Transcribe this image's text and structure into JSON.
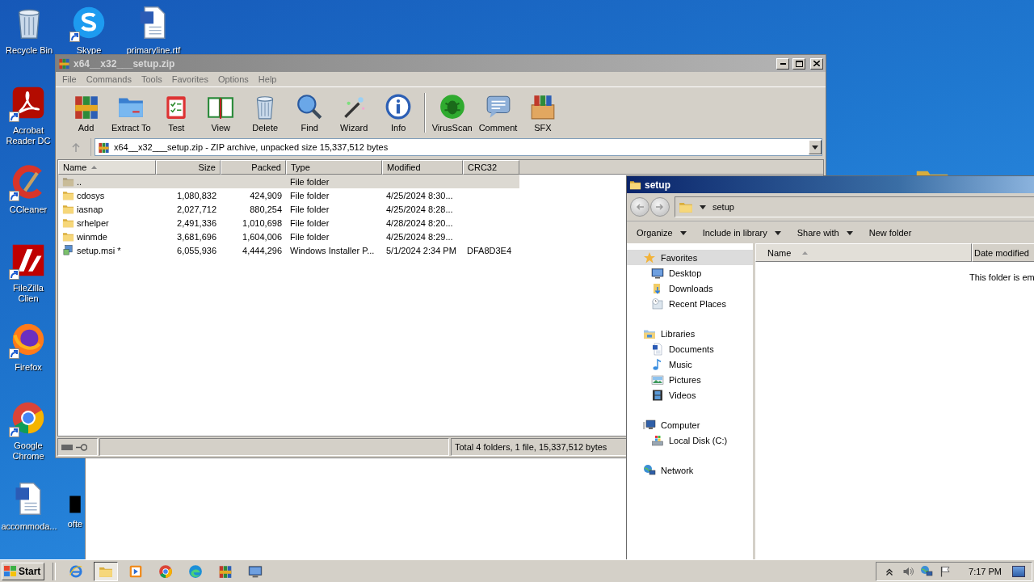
{
  "desktop_icons": [
    {
      "kind": "recycle-bin",
      "label": "Recycle Bin",
      "shortcut": false
    },
    {
      "kind": "skype",
      "label": "Skype",
      "shortcut": true
    },
    {
      "kind": "word-doc",
      "label": "primaryline.rtf",
      "shortcut": false
    },
    {
      "kind": "acrobat",
      "label": "Acrobat Reader DC",
      "shortcut": true
    },
    {
      "kind": "ccleaner",
      "label": "CCleaner",
      "shortcut": true
    },
    {
      "kind": "filezilla",
      "label": "FileZilla Clien",
      "shortcut": true
    },
    {
      "kind": "firefox",
      "label": "Firefox",
      "shortcut": true
    },
    {
      "kind": "chrome",
      "label": "Google Chrome",
      "shortcut": true
    },
    {
      "kind": "word-doc",
      "label": "accommoda...",
      "shortcut": false
    },
    {
      "kind": "dark-file",
      "label": "ofte",
      "shortcut": false
    },
    {
      "kind": "folder",
      "shortcut": false
    }
  ],
  "winrar": {
    "title": "x64__x32___setup.zip",
    "menu": [
      "File",
      "Commands",
      "Tools",
      "Favorites",
      "Options",
      "Help"
    ],
    "toolbar_groups": [
      [
        {
          "kind": "add",
          "label": "Add"
        },
        {
          "kind": "extract",
          "label": "Extract To"
        },
        {
          "kind": "test",
          "label": "Test"
        },
        {
          "kind": "view",
          "label": "View"
        },
        {
          "kind": "delete",
          "label": "Delete"
        },
        {
          "kind": "find",
          "label": "Find"
        },
        {
          "kind": "wizard",
          "label": "Wizard"
        },
        {
          "kind": "info",
          "label": "Info"
        }
      ],
      [
        {
          "kind": "virusscan",
          "label": "VirusScan"
        },
        {
          "kind": "comment",
          "label": "Comment"
        },
        {
          "kind": "sfx",
          "label": "SFX"
        }
      ]
    ],
    "address": "x64__x32___setup.zip - ZIP archive, unpacked size 15,337,512 bytes",
    "columns": [
      {
        "label": "Name",
        "sorted": true
      },
      {
        "label": "Size",
        "sorted": false
      },
      {
        "label": "Packed",
        "sorted": false
      },
      {
        "label": "Type",
        "sorted": false
      },
      {
        "label": "Modified",
        "sorted": false
      },
      {
        "label": "CRC32",
        "sorted": false
      }
    ],
    "rows": [
      {
        "kind": "parent-folder",
        "name": "..",
        "type": "File folder",
        "selected": true
      },
      {
        "kind": "folder",
        "name": "cdosys",
        "size": "1,080,832",
        "packed": "424,909",
        "type": "File folder",
        "modified": "4/25/2024 8:30...",
        "selected": false
      },
      {
        "kind": "folder",
        "name": "iasnap",
        "size": "2,027,712",
        "packed": "880,254",
        "type": "File folder",
        "modified": "4/25/2024 8:28...",
        "selected": false
      },
      {
        "kind": "folder",
        "name": "srhelper",
        "size": "2,491,336",
        "packed": "1,010,698",
        "type": "File folder",
        "modified": "4/28/2024 8:20...",
        "selected": false
      },
      {
        "kind": "folder",
        "name": "winmde",
        "size": "3,681,696",
        "packed": "1,604,006",
        "type": "File folder",
        "modified": "4/25/2024 8:29...",
        "selected": false
      },
      {
        "kind": "msi",
        "name": "setup.msi *",
        "size": "6,055,936",
        "packed": "4,444,296",
        "type": "Windows Installer P...",
        "modified": "5/1/2024 2:34 PM",
        "crc32": "DFA8D3E4",
        "selected": false
      }
    ],
    "status": "Total 4 folders, 1 file, 15,337,512 bytes"
  },
  "explorer": {
    "title": "setup",
    "address": "setup",
    "commands": [
      {
        "label": "Organize",
        "dropdown": true
      },
      {
        "label": "Include in library",
        "dropdown": true
      },
      {
        "label": "Share with",
        "dropdown": true
      },
      {
        "label": "New folder",
        "dropdown": false
      }
    ],
    "nav": [
      {
        "kind": "favorites",
        "label": "Favorites",
        "selected": true,
        "children": [
          {
            "kind": "desktop",
            "label": "Desktop",
            "selected": false
          },
          {
            "kind": "downloads",
            "label": "Downloads",
            "selected": false
          },
          {
            "kind": "recent",
            "label": "Recent Places",
            "selected": false
          }
        ]
      },
      {
        "kind": "libraries",
        "label": "Libraries",
        "selected": false,
        "children": [
          {
            "kind": "documents",
            "label": "Documents",
            "selected": false
          },
          {
            "kind": "music",
            "label": "Music",
            "selected": false
          },
          {
            "kind": "pictures",
            "label": "Pictures",
            "selected": false
          },
          {
            "kind": "videos",
            "label": "Videos",
            "selected": false
          }
        ]
      },
      {
        "kind": "computer",
        "label": "Computer",
        "selected": false,
        "children": [
          {
            "kind": "disk",
            "label": "Local Disk (C:)",
            "selected": false
          }
        ]
      },
      {
        "kind": "network",
        "label": "Network",
        "selected": false
      }
    ],
    "columns": [
      {
        "label": "Name",
        "sorted": true
      },
      {
        "label": "Date modified",
        "sorted": false
      }
    ],
    "empty_message": "This folder is em"
  },
  "taskbar": {
    "start": "Start",
    "apps": [
      {
        "kind": "ie",
        "selected": false
      },
      {
        "kind": "explorer",
        "selected": true
      },
      {
        "kind": "media-player",
        "selected": false
      },
      {
        "kind": "chrome",
        "selected": false
      },
      {
        "kind": "edge",
        "selected": false
      },
      {
        "kind": "winrar",
        "selected": false
      },
      {
        "kind": "remote-desktop",
        "selected": false
      }
    ],
    "tray": [
      {
        "kind": "show-hidden"
      },
      {
        "kind": "volume"
      },
      {
        "kind": "network"
      },
      {
        "kind": "flag"
      }
    ],
    "clock": "7:17 PM"
  }
}
